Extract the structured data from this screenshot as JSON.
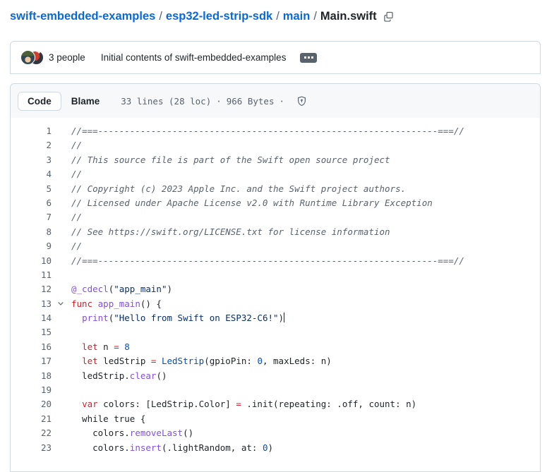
{
  "breadcrumb": {
    "repo": "swift-embedded-examples",
    "sep": "/",
    "path_parts": [
      "esp32-led-strip-sdk",
      "main"
    ],
    "current": "Main.swift",
    "copy_icon": "copy-icon"
  },
  "commit": {
    "authors": "3 people",
    "message": "Initial contents of swift-embedded-examples",
    "expand_label": "..."
  },
  "toolbar": {
    "tab_code": "Code",
    "tab_blame": "Blame",
    "lines": "33 lines (28 loc)",
    "separator": "·",
    "size": "966 Bytes",
    "shield_icon": "shield-check-icon"
  },
  "colors": {
    "link": "#0969da",
    "text": "#1f2328",
    "muted": "#59636e",
    "border": "#d1d9e0",
    "toolbar_bg": "#f6f8fa",
    "keyword": "#cf222e",
    "string": "#0a3069",
    "number": "#0550ae",
    "function": "#8250df",
    "type": "#0550ae",
    "comment": "#59636e"
  },
  "code": {
    "lines": [
      {
        "n": "1",
        "fold": false,
        "tokens": [
          {
            "t": "//===----------------------------------------------------------------===//",
            "c": "c-com"
          }
        ]
      },
      {
        "n": "2",
        "fold": false,
        "tokens": [
          {
            "t": "//",
            "c": "c-com"
          }
        ]
      },
      {
        "n": "3",
        "fold": false,
        "tokens": [
          {
            "t": "// This source file is part of the Swift open source project",
            "c": "c-com"
          }
        ]
      },
      {
        "n": "4",
        "fold": false,
        "tokens": [
          {
            "t": "//",
            "c": "c-com"
          }
        ]
      },
      {
        "n": "5",
        "fold": false,
        "tokens": [
          {
            "t": "// Copyright (c) 2023 Apple Inc. and the Swift project authors.",
            "c": "c-com"
          }
        ]
      },
      {
        "n": "6",
        "fold": false,
        "tokens": [
          {
            "t": "// Licensed under Apache License v2.0 with Runtime Library Exception",
            "c": "c-com"
          }
        ]
      },
      {
        "n": "7",
        "fold": false,
        "tokens": [
          {
            "t": "//",
            "c": "c-com"
          }
        ]
      },
      {
        "n": "8",
        "fold": false,
        "tokens": [
          {
            "t": "// See https://swift.org/LICENSE.txt for license information",
            "c": "c-com"
          }
        ]
      },
      {
        "n": "9",
        "fold": false,
        "tokens": [
          {
            "t": "//",
            "c": "c-com"
          }
        ]
      },
      {
        "n": "10",
        "fold": false,
        "tokens": [
          {
            "t": "//===----------------------------------------------------------------===//",
            "c": "c-com"
          }
        ]
      },
      {
        "n": "11",
        "fold": false,
        "tokens": []
      },
      {
        "n": "12",
        "fold": false,
        "tokens": [
          {
            "t": "@_cdecl",
            "c": "c-attr"
          },
          {
            "t": "(",
            "c": ""
          },
          {
            "t": "\"app_main\"",
            "c": "c-str"
          },
          {
            "t": ")",
            "c": ""
          }
        ]
      },
      {
        "n": "13",
        "fold": true,
        "tokens": [
          {
            "t": "func ",
            "c": "c-kw"
          },
          {
            "t": "app_main",
            "c": "c-fn"
          },
          {
            "t": "() {",
            "c": ""
          }
        ]
      },
      {
        "n": "14",
        "fold": false,
        "tokens": [
          {
            "t": "  ",
            "c": ""
          },
          {
            "t": "print",
            "c": "c-fn"
          },
          {
            "t": "(",
            "c": ""
          },
          {
            "t": "\"Hello from Swift on ESP32-C6!\"",
            "c": "c-str"
          },
          {
            "t": ")",
            "c": ""
          },
          {
            "t": "",
            "c": "caret-mark"
          }
        ]
      },
      {
        "n": "15",
        "fold": false,
        "tokens": []
      },
      {
        "n": "16",
        "fold": false,
        "tokens": [
          {
            "t": "  ",
            "c": ""
          },
          {
            "t": "let",
            "c": "c-kw"
          },
          {
            "t": " n ",
            "c": ""
          },
          {
            "t": "=",
            "c": "c-kw"
          },
          {
            "t": " ",
            "c": ""
          },
          {
            "t": "8",
            "c": "c-num"
          }
        ]
      },
      {
        "n": "17",
        "fold": false,
        "tokens": [
          {
            "t": "  ",
            "c": ""
          },
          {
            "t": "let",
            "c": "c-kw"
          },
          {
            "t": " ledStrip ",
            "c": ""
          },
          {
            "t": "=",
            "c": "c-kw"
          },
          {
            "t": " ",
            "c": ""
          },
          {
            "t": "LedStrip",
            "c": "c-type"
          },
          {
            "t": "(gpioPin: ",
            "c": ""
          },
          {
            "t": "0",
            "c": "c-num"
          },
          {
            "t": ", maxLeds: n)",
            "c": ""
          }
        ]
      },
      {
        "n": "18",
        "fold": false,
        "tokens": [
          {
            "t": "  ledStrip.",
            "c": ""
          },
          {
            "t": "clear",
            "c": "c-fn"
          },
          {
            "t": "()",
            "c": ""
          }
        ]
      },
      {
        "n": "19",
        "fold": false,
        "tokens": []
      },
      {
        "n": "20",
        "fold": false,
        "tokens": [
          {
            "t": "  ",
            "c": ""
          },
          {
            "t": "var",
            "c": "c-kw"
          },
          {
            "t": " colors: [LedStrip.Color] ",
            "c": ""
          },
          {
            "t": "=",
            "c": "c-kw"
          },
          {
            "t": " .init(repeating: .off, count: n)",
            "c": ""
          }
        ]
      },
      {
        "n": "21",
        "fold": false,
        "tokens": [
          {
            "t": "  while true {",
            "c": ""
          }
        ]
      },
      {
        "n": "22",
        "fold": false,
        "tokens": [
          {
            "t": "    colors.",
            "c": ""
          },
          {
            "t": "removeLast",
            "c": "c-fn"
          },
          {
            "t": "()",
            "c": ""
          }
        ]
      },
      {
        "n": "23",
        "fold": false,
        "tokens": [
          {
            "t": "    colors.",
            "c": ""
          },
          {
            "t": "insert",
            "c": "c-fn"
          },
          {
            "t": "(.lightRandom, at: ",
            "c": ""
          },
          {
            "t": "0",
            "c": "c-num"
          },
          {
            "t": ")",
            "c": ""
          }
        ]
      }
    ]
  }
}
